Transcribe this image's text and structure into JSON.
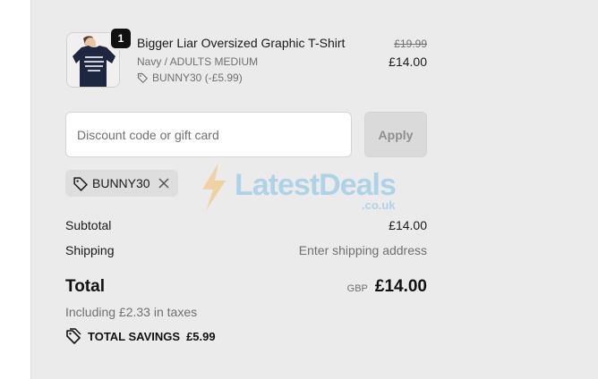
{
  "product": {
    "quantity": "1",
    "title": "Bigger Liar Oversized Graphic T-Shirt",
    "variant": "Navy / ADULTS MEDIUM",
    "discount_line": "BUNNY30 (-£5.99)",
    "original_price": "£19.99",
    "price": "£14.00",
    "image_icon": "tshirt-thumbnail"
  },
  "discount": {
    "placeholder": "Discount code or gift card",
    "value": "",
    "apply_label": "Apply",
    "applied_code": "BUNNY30"
  },
  "totals": {
    "subtotal_label": "Subtotal",
    "subtotal_value": "£14.00",
    "shipping_label": "Shipping",
    "shipping_value": "Enter shipping address",
    "total_label": "Total",
    "currency": "GBP",
    "total_value": "£14.00",
    "taxes": "Including £2.33 in taxes",
    "savings_label": "TOTAL SAVINGS",
    "savings_value": "£5.99"
  },
  "watermark": {
    "text": "LatestDeals",
    "sub": ".co.uk"
  },
  "colors": {
    "summary_bg": "#ebebeb",
    "muted_text": "#707070",
    "apply_disabled_bg": "#dadada",
    "chip_bg": "#dedede"
  }
}
